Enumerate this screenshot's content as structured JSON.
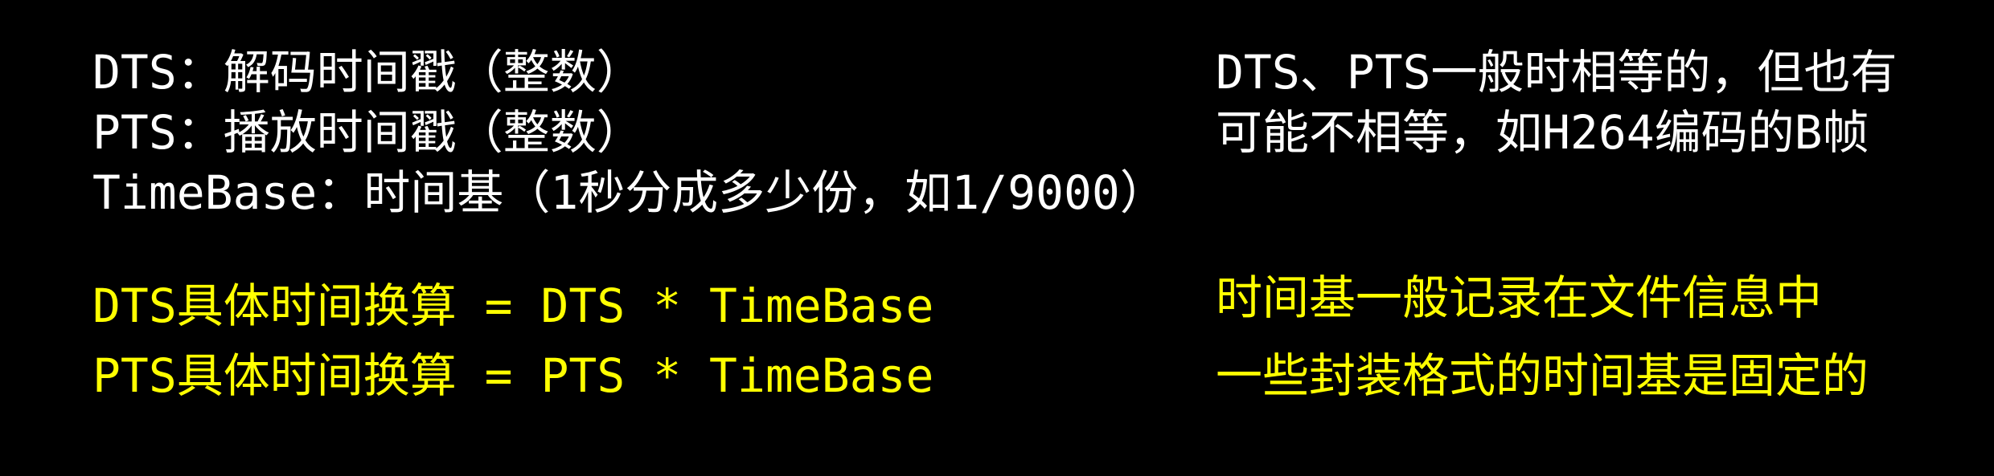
{
  "left": {
    "line1": "DTS：解码时间戳（整数）",
    "line2": "PTS：播放时间戳（整数）",
    "line3": "TimeBase：时间基（1秒分成多少份，如1/9000）",
    "line4": "DTS具体时间换算 = DTS * TimeBase",
    "line5": "PTS具体时间换算 = PTS * TimeBase"
  },
  "right": {
    "line1": "DTS、PTS一般时相等的，但也有",
    "line2": "可能不相等，如H264编码的B帧",
    "line3": "时间基一般记录在文件信息中",
    "line4": "一些封装格式的时间基是固定的"
  },
  "colors": {
    "background": "#000000",
    "primary_text": "#ffffff",
    "highlight_text": "#ffff00"
  }
}
